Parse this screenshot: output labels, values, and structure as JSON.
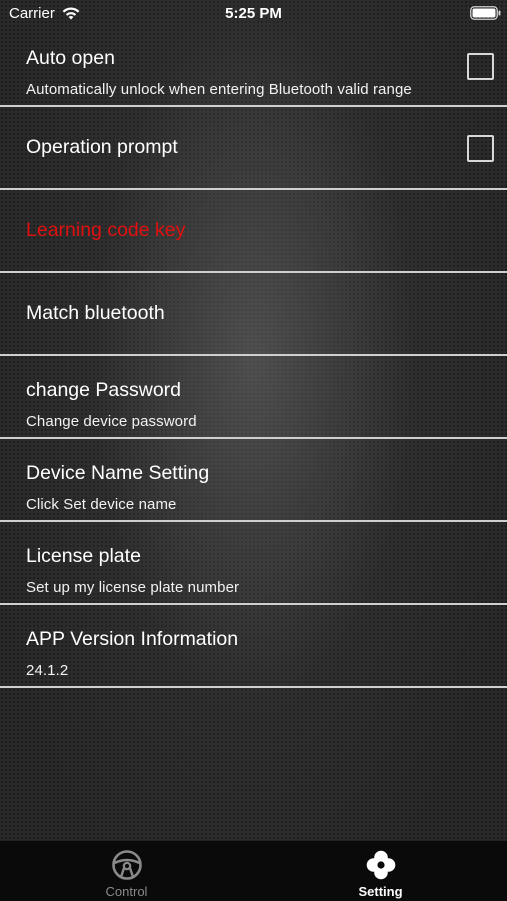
{
  "status_bar": {
    "carrier": "Carrier",
    "time": "5:25 PM"
  },
  "rows": [
    {
      "title": "Auto open",
      "subtitle": "Automatically unlock when entering Bluetooth valid range",
      "checkbox": false
    },
    {
      "title": "Operation prompt",
      "checkbox": false
    },
    {
      "title": "Learning code key",
      "color": "#e01010"
    },
    {
      "title": "Match bluetooth"
    },
    {
      "title": "change Password",
      "subtitle": "Change device password"
    },
    {
      "title": "Device Name Setting",
      "subtitle": "Click Set device name"
    },
    {
      "title": "License plate",
      "subtitle": "Set up my license plate number"
    },
    {
      "title": "APP Version Information",
      "subtitle": "24.1.2"
    }
  ],
  "tab_bar": {
    "tabs": [
      {
        "label": "Control",
        "icon": "steering-wheel-icon",
        "selected": false
      },
      {
        "label": "Setting",
        "icon": "settings-clover-icon",
        "selected": true
      }
    ]
  }
}
